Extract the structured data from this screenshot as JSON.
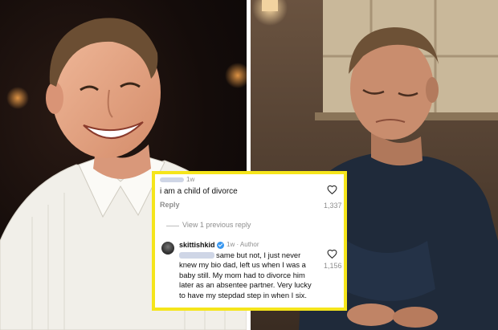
{
  "comments": [
    {
      "time": "1w",
      "text": "i am a child of divorce",
      "reply_label": "Reply",
      "likes": "1,337"
    },
    {
      "username": "skittishkid",
      "time": "1w",
      "role": "Author",
      "text": "same but not, I just never knew my bio dad, left us when I was a baby still. My mom had to divorce him later as an absentee partner. Very lucky to have my stepdad step in when I six.",
      "likes": "1,156"
    }
  ],
  "view_previous_label": "View 1 previous reply",
  "colors": {
    "highlight_border": "#f5e51b",
    "divider": "#ffffff",
    "verified_badge": "#3897f0"
  },
  "icons": [
    "heart-icon",
    "verified-badge-icon"
  ]
}
